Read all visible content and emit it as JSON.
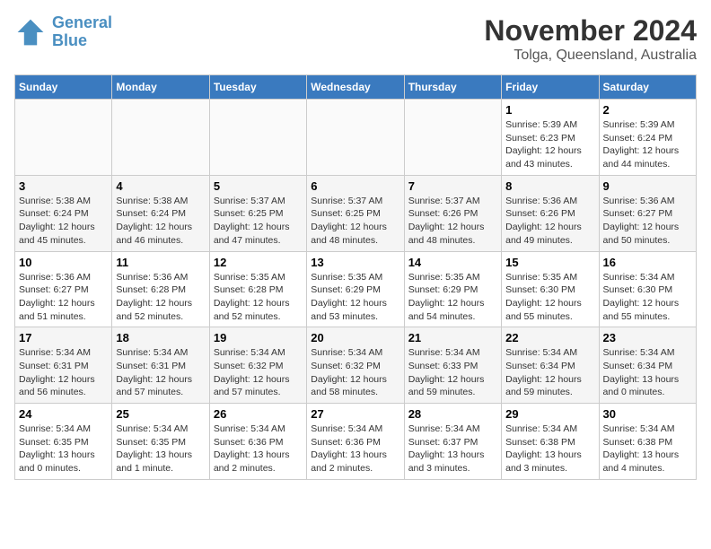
{
  "logo": {
    "line1": "General",
    "line2": "Blue"
  },
  "title": "November 2024",
  "location": "Tolga, Queensland, Australia",
  "weekdays": [
    "Sunday",
    "Monday",
    "Tuesday",
    "Wednesday",
    "Thursday",
    "Friday",
    "Saturday"
  ],
  "weeks": [
    [
      {
        "day": "",
        "sunrise": "",
        "sunset": "",
        "daylight": ""
      },
      {
        "day": "",
        "sunrise": "",
        "sunset": "",
        "daylight": ""
      },
      {
        "day": "",
        "sunrise": "",
        "sunset": "",
        "daylight": ""
      },
      {
        "day": "",
        "sunrise": "",
        "sunset": "",
        "daylight": ""
      },
      {
        "day": "",
        "sunrise": "",
        "sunset": "",
        "daylight": ""
      },
      {
        "day": "1",
        "sunrise": "Sunrise: 5:39 AM",
        "sunset": "Sunset: 6:23 PM",
        "daylight": "Daylight: 12 hours and 43 minutes."
      },
      {
        "day": "2",
        "sunrise": "Sunrise: 5:39 AM",
        "sunset": "Sunset: 6:24 PM",
        "daylight": "Daylight: 12 hours and 44 minutes."
      }
    ],
    [
      {
        "day": "3",
        "sunrise": "Sunrise: 5:38 AM",
        "sunset": "Sunset: 6:24 PM",
        "daylight": "Daylight: 12 hours and 45 minutes."
      },
      {
        "day": "4",
        "sunrise": "Sunrise: 5:38 AM",
        "sunset": "Sunset: 6:24 PM",
        "daylight": "Daylight: 12 hours and 46 minutes."
      },
      {
        "day": "5",
        "sunrise": "Sunrise: 5:37 AM",
        "sunset": "Sunset: 6:25 PM",
        "daylight": "Daylight: 12 hours and 47 minutes."
      },
      {
        "day": "6",
        "sunrise": "Sunrise: 5:37 AM",
        "sunset": "Sunset: 6:25 PM",
        "daylight": "Daylight: 12 hours and 48 minutes."
      },
      {
        "day": "7",
        "sunrise": "Sunrise: 5:37 AM",
        "sunset": "Sunset: 6:26 PM",
        "daylight": "Daylight: 12 hours and 48 minutes."
      },
      {
        "day": "8",
        "sunrise": "Sunrise: 5:36 AM",
        "sunset": "Sunset: 6:26 PM",
        "daylight": "Daylight: 12 hours and 49 minutes."
      },
      {
        "day": "9",
        "sunrise": "Sunrise: 5:36 AM",
        "sunset": "Sunset: 6:27 PM",
        "daylight": "Daylight: 12 hours and 50 minutes."
      }
    ],
    [
      {
        "day": "10",
        "sunrise": "Sunrise: 5:36 AM",
        "sunset": "Sunset: 6:27 PM",
        "daylight": "Daylight: 12 hours and 51 minutes."
      },
      {
        "day": "11",
        "sunrise": "Sunrise: 5:36 AM",
        "sunset": "Sunset: 6:28 PM",
        "daylight": "Daylight: 12 hours and 52 minutes."
      },
      {
        "day": "12",
        "sunrise": "Sunrise: 5:35 AM",
        "sunset": "Sunset: 6:28 PM",
        "daylight": "Daylight: 12 hours and 52 minutes."
      },
      {
        "day": "13",
        "sunrise": "Sunrise: 5:35 AM",
        "sunset": "Sunset: 6:29 PM",
        "daylight": "Daylight: 12 hours and 53 minutes."
      },
      {
        "day": "14",
        "sunrise": "Sunrise: 5:35 AM",
        "sunset": "Sunset: 6:29 PM",
        "daylight": "Daylight: 12 hours and 54 minutes."
      },
      {
        "day": "15",
        "sunrise": "Sunrise: 5:35 AM",
        "sunset": "Sunset: 6:30 PM",
        "daylight": "Daylight: 12 hours and 55 minutes."
      },
      {
        "day": "16",
        "sunrise": "Sunrise: 5:34 AM",
        "sunset": "Sunset: 6:30 PM",
        "daylight": "Daylight: 12 hours and 55 minutes."
      }
    ],
    [
      {
        "day": "17",
        "sunrise": "Sunrise: 5:34 AM",
        "sunset": "Sunset: 6:31 PM",
        "daylight": "Daylight: 12 hours and 56 minutes."
      },
      {
        "day": "18",
        "sunrise": "Sunrise: 5:34 AM",
        "sunset": "Sunset: 6:31 PM",
        "daylight": "Daylight: 12 hours and 57 minutes."
      },
      {
        "day": "19",
        "sunrise": "Sunrise: 5:34 AM",
        "sunset": "Sunset: 6:32 PM",
        "daylight": "Daylight: 12 hours and 57 minutes."
      },
      {
        "day": "20",
        "sunrise": "Sunrise: 5:34 AM",
        "sunset": "Sunset: 6:32 PM",
        "daylight": "Daylight: 12 hours and 58 minutes."
      },
      {
        "day": "21",
        "sunrise": "Sunrise: 5:34 AM",
        "sunset": "Sunset: 6:33 PM",
        "daylight": "Daylight: 12 hours and 59 minutes."
      },
      {
        "day": "22",
        "sunrise": "Sunrise: 5:34 AM",
        "sunset": "Sunset: 6:34 PM",
        "daylight": "Daylight: 12 hours and 59 minutes."
      },
      {
        "day": "23",
        "sunrise": "Sunrise: 5:34 AM",
        "sunset": "Sunset: 6:34 PM",
        "daylight": "Daylight: 13 hours and 0 minutes."
      }
    ],
    [
      {
        "day": "24",
        "sunrise": "Sunrise: 5:34 AM",
        "sunset": "Sunset: 6:35 PM",
        "daylight": "Daylight: 13 hours and 0 minutes."
      },
      {
        "day": "25",
        "sunrise": "Sunrise: 5:34 AM",
        "sunset": "Sunset: 6:35 PM",
        "daylight": "Daylight: 13 hours and 1 minute."
      },
      {
        "day": "26",
        "sunrise": "Sunrise: 5:34 AM",
        "sunset": "Sunset: 6:36 PM",
        "daylight": "Daylight: 13 hours and 2 minutes."
      },
      {
        "day": "27",
        "sunrise": "Sunrise: 5:34 AM",
        "sunset": "Sunset: 6:36 PM",
        "daylight": "Daylight: 13 hours and 2 minutes."
      },
      {
        "day": "28",
        "sunrise": "Sunrise: 5:34 AM",
        "sunset": "Sunset: 6:37 PM",
        "daylight": "Daylight: 13 hours and 3 minutes."
      },
      {
        "day": "29",
        "sunrise": "Sunrise: 5:34 AM",
        "sunset": "Sunset: 6:38 PM",
        "daylight": "Daylight: 13 hours and 3 minutes."
      },
      {
        "day": "30",
        "sunrise": "Sunrise: 5:34 AM",
        "sunset": "Sunset: 6:38 PM",
        "daylight": "Daylight: 13 hours and 4 minutes."
      }
    ]
  ]
}
